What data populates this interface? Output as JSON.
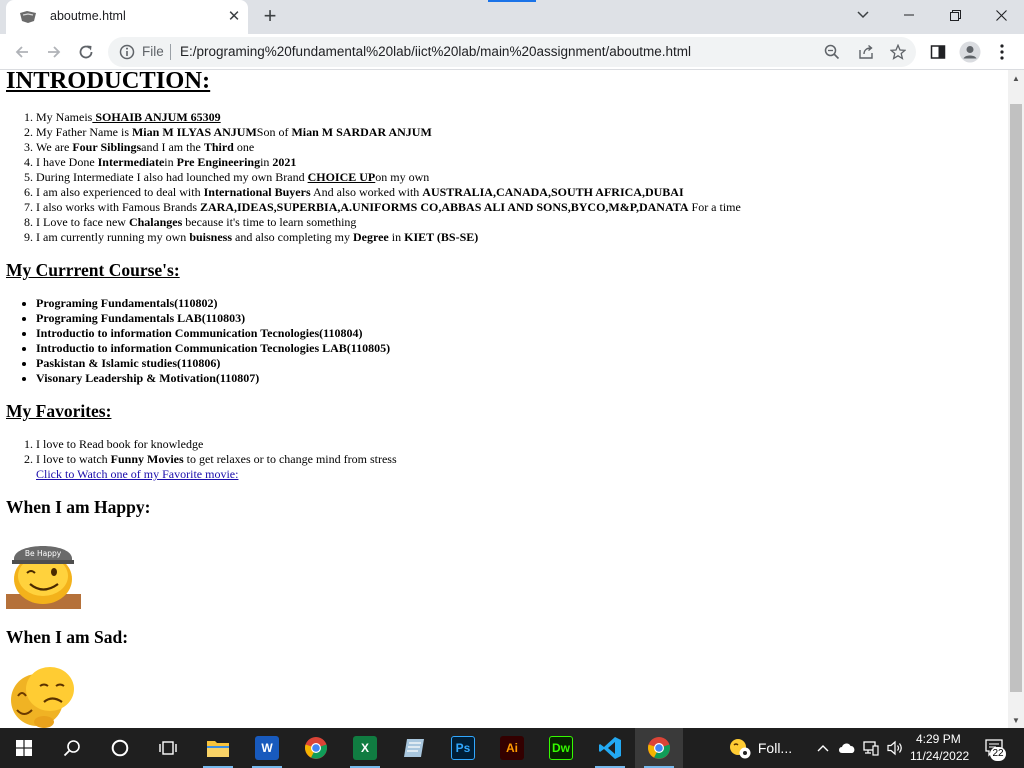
{
  "browser": {
    "tab_title": "aboutme.html",
    "tab_close": "✕",
    "new_tab": "+",
    "scheme_label": "File",
    "url": "E:/programing%20fundamental%20lab/iict%20lab/main%20assignment/aboutme.html"
  },
  "page": {
    "heading": "INTRODUCTION:",
    "intro": {
      "item1": {
        "pre": "My Nameis",
        "name": " SOHAIB ANJUM 65309"
      },
      "item2": {
        "pre": "My Father Name is ",
        "father": "Mian M ILYAS ANJUM",
        "mid": "Son of ",
        "grandfather": "Mian M SARDAR ANJUM"
      },
      "item3": {
        "pre": "We are ",
        "siblings": "Four Siblings",
        "mid": "and I am the ",
        "order": "Third",
        "post": " one"
      },
      "item4": {
        "pre": "I have Done ",
        "level": "Intermediate",
        "mid": "in ",
        "field": "Pre Engineering",
        "mid2": "in ",
        "year": "2021"
      },
      "item5": {
        "pre": "During Intermediate I also had lounched my own Brand ",
        "brand": "CHOICE UP",
        "post": "on my own"
      },
      "item6": {
        "pre": "I am also experienced to deal with ",
        "buyers": "International Buyers",
        "mid": " And also worked with ",
        "countries": "AUSTRALIA,CANADA,SOUTH AFRICA,DUBAI"
      },
      "item7": {
        "pre": "I also works with Famous Brands ",
        "brands": "ZARA,IDEAS,SUPERBIA,A.UNIFORMS CO,ABBAS ALI AND SONS,BYCO,M&P,DANATA",
        "post": " For a time"
      },
      "item8": {
        "pre": "I Love to face new ",
        "word": "Chalanges",
        "post": " because it's time to learn something"
      },
      "item9": {
        "pre": "I am currently running my own ",
        "business": "buisness",
        "mid": " and also completing my ",
        "degree": "Degree",
        "mid2": " in ",
        "uni": "KIET (BS-SE)"
      }
    },
    "courses_heading": "My Currrent Course's:",
    "courses": [
      "Programing Fundamentals(110802)",
      "Programing Fundamentals LAB(110803)",
      "Introductio to information Communication Tecnologies(110804)",
      "Introductio to information Communication Tecnologies LAB(110805)",
      "Paskistan & Islamic studies(110806)",
      "Visonary Leadership & Motivation(110807)"
    ],
    "favorites_heading": "My Favorites:",
    "fav1": "I love to Read book for knowledge",
    "fav2": {
      "pre": "I love to watch ",
      "movies": "Funny Movies",
      "post": " to get relaxes or to change mind from stress"
    },
    "movie_link": "Click to Watch one of my Favorite movie:",
    "happy_heading": "When I am Happy:",
    "happy_image_text": "Be Happy",
    "sad_heading": "When I am Sad:"
  },
  "taskbar": {
    "pinned_label": "Foll...",
    "word": "W",
    "excel": "X",
    "photoshop": "Ps",
    "illustrator": "Ai",
    "dreamweaver": "Dw",
    "time": "4:29 PM",
    "date": "11/24/2022",
    "notifications": "22"
  },
  "colors": {
    "accent": "#1a73e8",
    "link": "#1a0dab",
    "taskbar": "#1f1f1f",
    "word": "#185abd",
    "excel": "#107c41",
    "photoshop": "#001e36",
    "illustrator": "#330000",
    "dreamweaver": "#072401"
  },
  "icons": {
    "tab_favicon": "file-favicon-icon",
    "back": "back-arrow-icon",
    "forward": "forward-arrow-icon",
    "reload": "reload-icon",
    "info": "info-icon",
    "zoom": "zoom-icon",
    "share": "share-icon",
    "bookmark": "star-icon",
    "sidepanel": "side-panel-icon",
    "profile": "profile-icon",
    "menu": "kebab-menu-icon"
  }
}
